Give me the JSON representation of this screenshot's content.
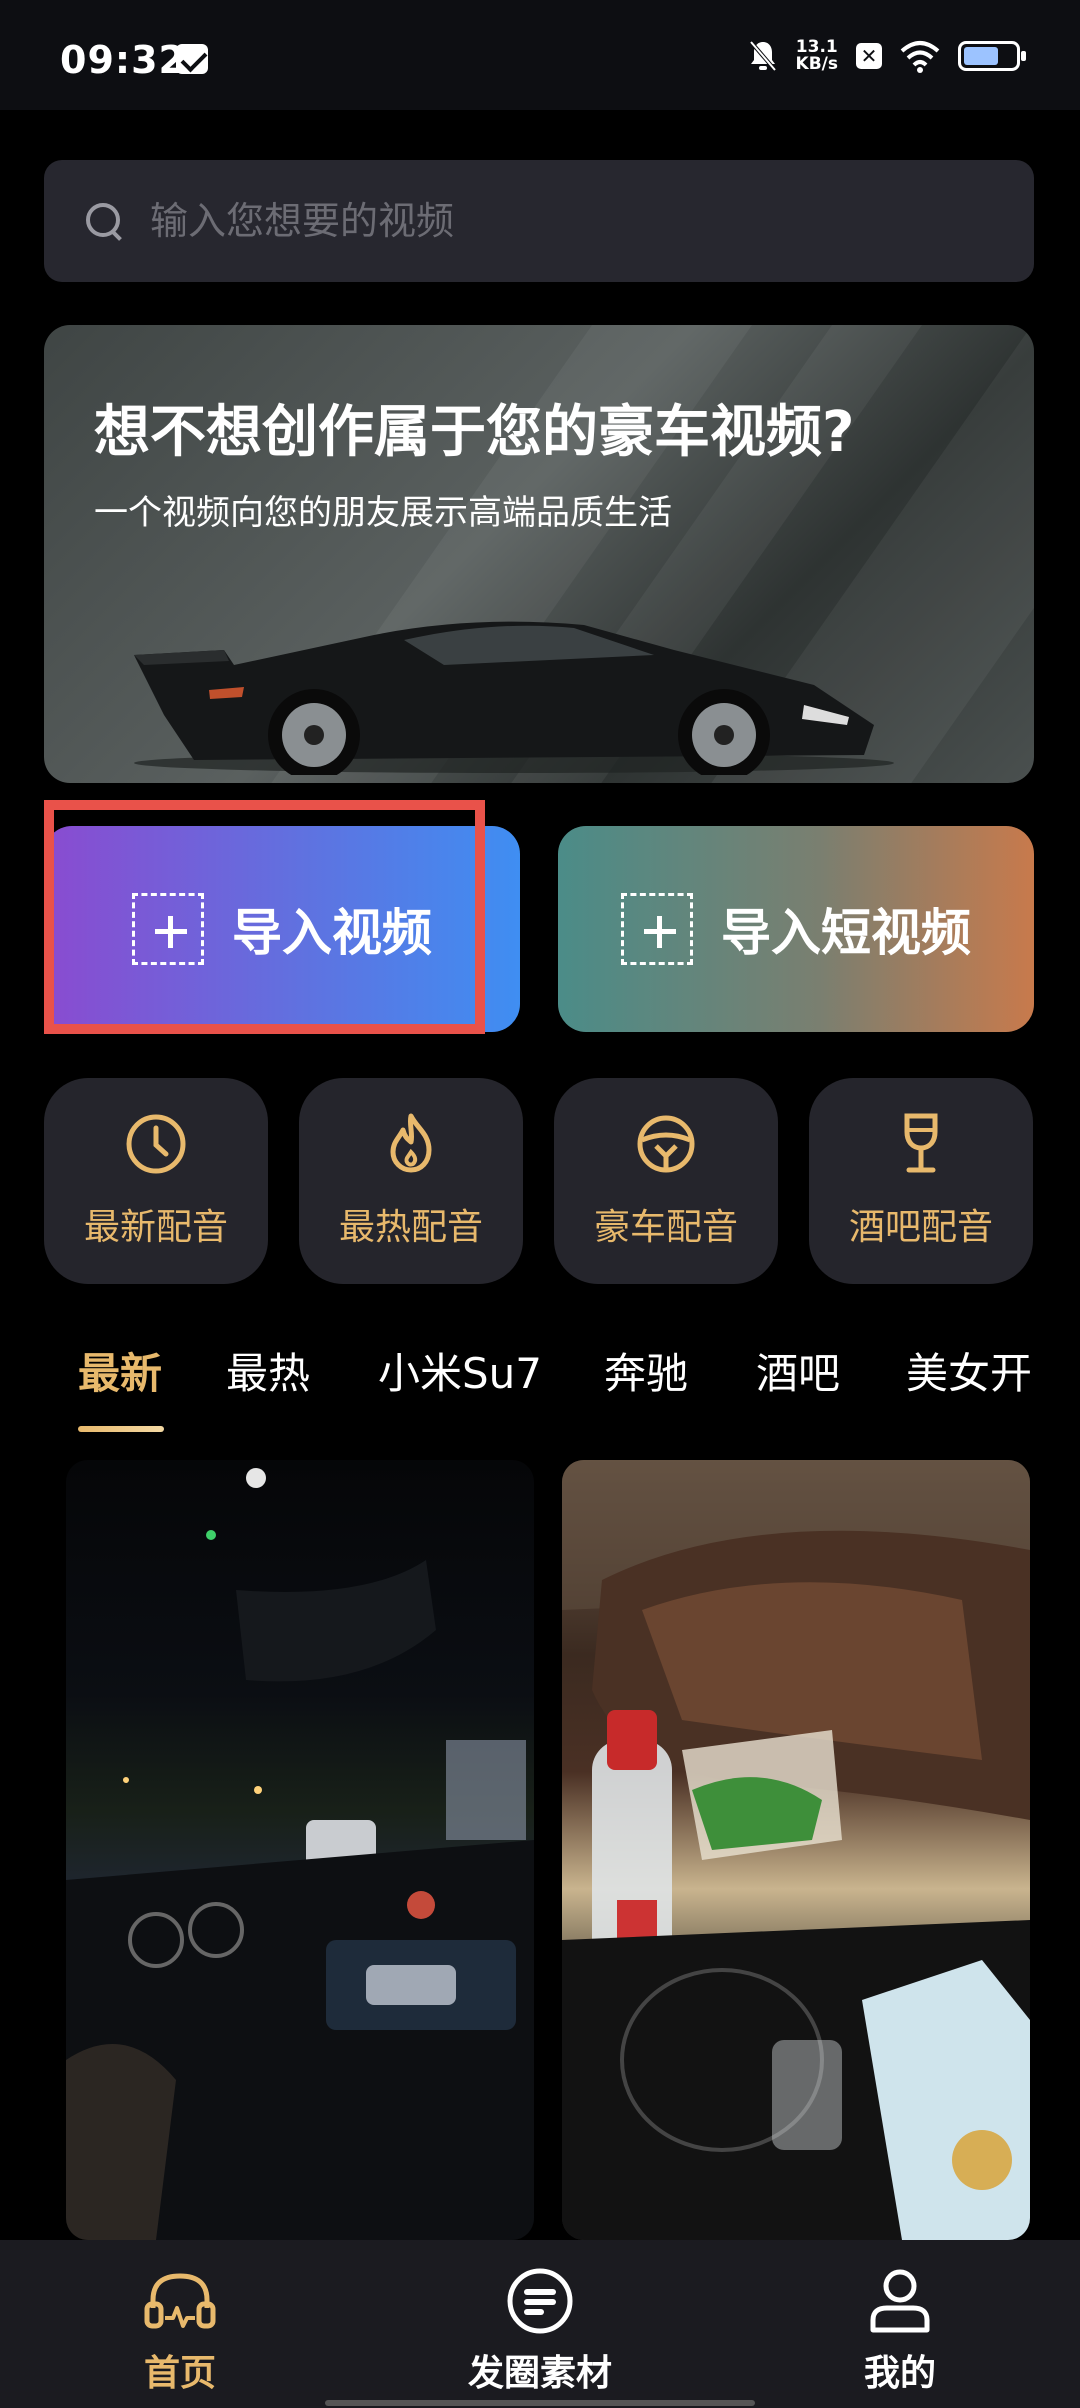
{
  "status_bar": {
    "time": "09:32",
    "net_speed_value": "13.1",
    "net_speed_unit": "KB/s",
    "icons": [
      "message-icon",
      "mute-bell-icon",
      "sim-off-icon",
      "wifi-icon",
      "battery-icon"
    ]
  },
  "search": {
    "placeholder": "输入您想要的视频",
    "value": ""
  },
  "banner": {
    "title": "想不想创作属于您的豪车视频?",
    "subtitle": "一个视频向您的朋友展示高端品质生活"
  },
  "import": {
    "video_label": "导入视频",
    "short_video_label": "导入短视频"
  },
  "categories": [
    {
      "label": "最新配音",
      "icon": "clock-icon"
    },
    {
      "label": "最热配音",
      "icon": "flame-icon"
    },
    {
      "label": "豪车配音",
      "icon": "steering-wheel-icon"
    },
    {
      "label": "酒吧配音",
      "icon": "wine-glass-icon"
    }
  ],
  "tabs": [
    "最新",
    "最热",
    "小米Su7",
    "奔驰",
    "酒吧",
    "美女开"
  ],
  "active_tab": "最新",
  "colors": {
    "accent_gold": "#e8b96c",
    "highlight_red": "#e9524a",
    "import_video_gradient": [
      "#8a4bd0",
      "#3f8ef2"
    ],
    "import_short_gradient": [
      "#4b8c88",
      "#c87a4c"
    ]
  },
  "bottom_nav": {
    "items": [
      {
        "label": "首页",
        "icon": "home-headphone-icon",
        "active": true
      },
      {
        "label": "发圈素材",
        "icon": "material-list-icon",
        "active": false
      },
      {
        "label": "我的",
        "icon": "user-icon",
        "active": false
      }
    ]
  }
}
